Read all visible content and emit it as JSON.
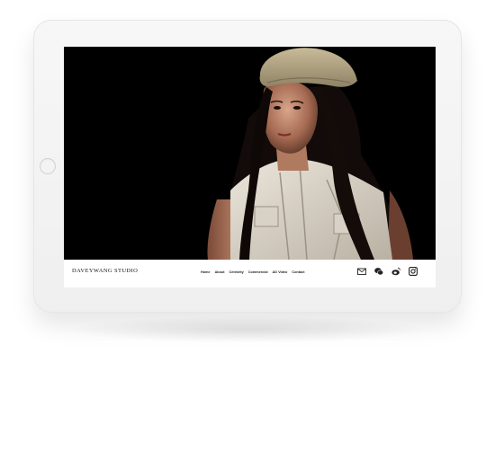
{
  "site": {
    "brand": "DAVEYWANG STUDIO",
    "nav": [
      {
        "label": "Home"
      },
      {
        "label": "About"
      },
      {
        "label": "Celebrity"
      },
      {
        "label": "Commercial"
      },
      {
        "label": "AD Video"
      },
      {
        "label": "Contact"
      }
    ],
    "social_icons": [
      "mail-icon",
      "wechat-icon",
      "weibo-icon",
      "instagram-icon"
    ]
  },
  "colors": {
    "hero_background": "#000000",
    "navbar_background": "#ffffff",
    "device_frame": "#f4f4f4"
  }
}
